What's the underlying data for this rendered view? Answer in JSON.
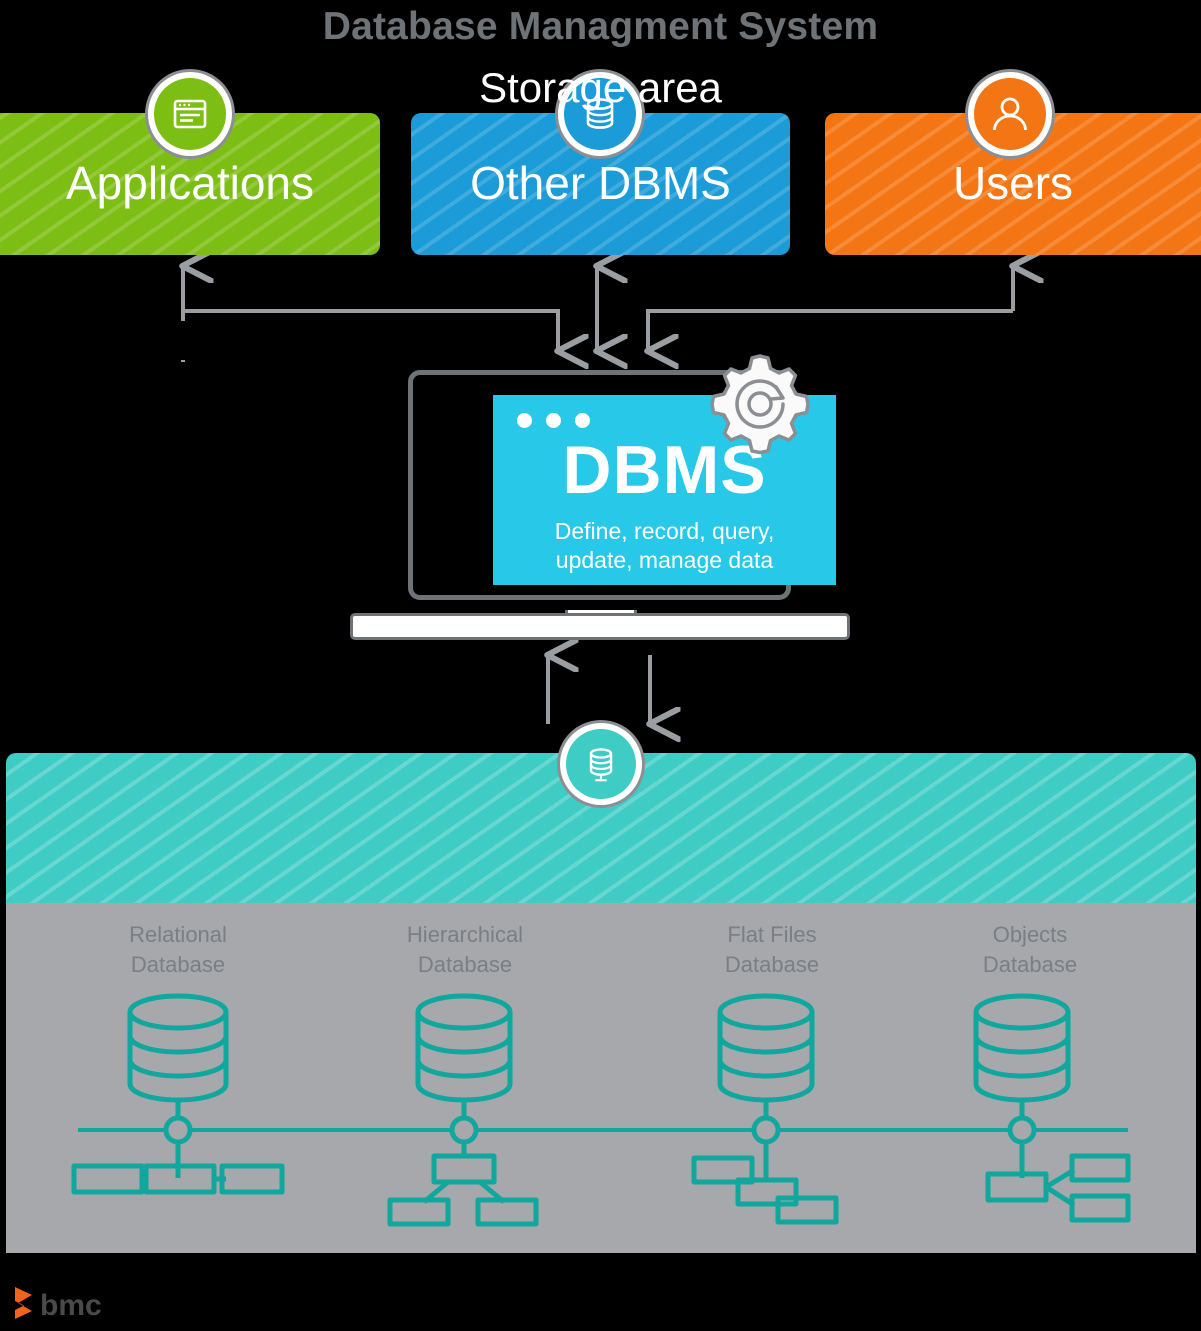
{
  "title": "Database Managment System",
  "colors": {
    "green": "#7DBE14",
    "blue": "#1B9BD7",
    "orange": "#F47513",
    "cyan": "#28C8E8",
    "teal": "#3FCCC4",
    "gray_panel": "#A6A8AB",
    "gray_text": "#6E7377",
    "white": "#FFFFFF",
    "bmc_orange": "#F4631E",
    "bmc_text": "#4A4A4A"
  },
  "sources": [
    {
      "id": "applications",
      "label": "Applications",
      "icon": "window-icon",
      "color": "#7DBE14"
    },
    {
      "id": "other-dbms",
      "label": "Other DBMS",
      "icon": "database-icon",
      "color": "#1B9BD7"
    },
    {
      "id": "users",
      "label": "Users",
      "icon": "user-icon",
      "color": "#F47513"
    }
  ],
  "dbms": {
    "screen_title": "DBMS",
    "screen_subtitle_line1": "Define, record, query,",
    "screen_subtitle_line2": "update, manage data",
    "gear_icon": "gear-refresh-icon",
    "dots": 3
  },
  "storage": {
    "label": "Storage area",
    "icon": "database-icon",
    "databases": [
      {
        "id": "relational",
        "line1": "Relational",
        "line2": "Database",
        "diagram": "row-of-three-boxes"
      },
      {
        "id": "hierarchical",
        "line1": "Hierarchical",
        "line2": "Database",
        "diagram": "tree-two-children"
      },
      {
        "id": "flat-files",
        "line1": "Flat Files",
        "line2": "Database",
        "diagram": "staggered-boxes"
      },
      {
        "id": "objects",
        "line1": "Objects",
        "line2": "Database",
        "diagram": "box-with-two-linked-boxes"
      }
    ]
  },
  "footer": {
    "logo_text": "bmc"
  }
}
